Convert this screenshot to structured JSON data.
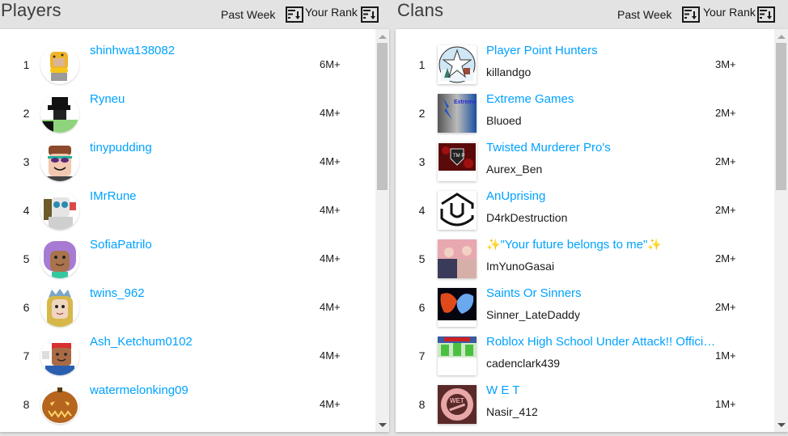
{
  "players": {
    "title": "Players",
    "time_filter": "Past Week",
    "rank_filter": "Your Rank",
    "icons": [
      "sort-icon",
      "sort-icon"
    ],
    "rows": [
      {
        "rank": "1",
        "name": "shinhwa138082",
        "points": "6M+"
      },
      {
        "rank": "2",
        "name": "Ryneu",
        "points": "4M+"
      },
      {
        "rank": "3",
        "name": "tinypudding",
        "points": "4M+"
      },
      {
        "rank": "4",
        "name": "IMrRune",
        "points": "4M+"
      },
      {
        "rank": "5",
        "name": "SofiaPatrilo",
        "points": "4M+"
      },
      {
        "rank": "6",
        "name": "twins_962",
        "points": "4M+"
      },
      {
        "rank": "7",
        "name": "Ash_Ketchum0102",
        "points": "4M+"
      },
      {
        "rank": "8",
        "name": "watermelonking09",
        "points": "4M+"
      }
    ]
  },
  "clans": {
    "title": "Clans",
    "time_filter": "Past Week",
    "rank_filter": "Your Rank",
    "rows": [
      {
        "rank": "1",
        "name": "Player Point Hunters",
        "owner": "killandgo",
        "points": "3M+"
      },
      {
        "rank": "2",
        "name": "Extreme Games",
        "owner": "Bluoed",
        "points": "2M+"
      },
      {
        "rank": "3",
        "name": "Twisted Murderer Pro's",
        "owner": "Aurex_Ben",
        "points": "2M+"
      },
      {
        "rank": "4",
        "name": "AnUprising",
        "owner": "D4rkDestruction",
        "points": "2M+"
      },
      {
        "rank": "5",
        "name": "\"Your future belongs to me\"",
        "owner": "ImYunoGasai",
        "points": "2M+"
      },
      {
        "rank": "6",
        "name": "Saints Or Sinners",
        "owner": "Sinner_LateDaddy",
        "points": "2M+"
      },
      {
        "rank": "7",
        "name": "Roblox High School Under Attack!! Official Group",
        "owner": "cadenclark439",
        "points": "1M+"
      },
      {
        "rank": "8",
        "name": "W E T",
        "owner": "Nasir_412",
        "points": "1M+"
      }
    ],
    "emblem_text": {
      "extreme": "Extreme Games",
      "tmp": "TM P",
      "wet": "WET"
    }
  },
  "colors": {
    "link": "#00a2ff",
    "text": "#191919",
    "header_bg": "#e3e3e3"
  }
}
